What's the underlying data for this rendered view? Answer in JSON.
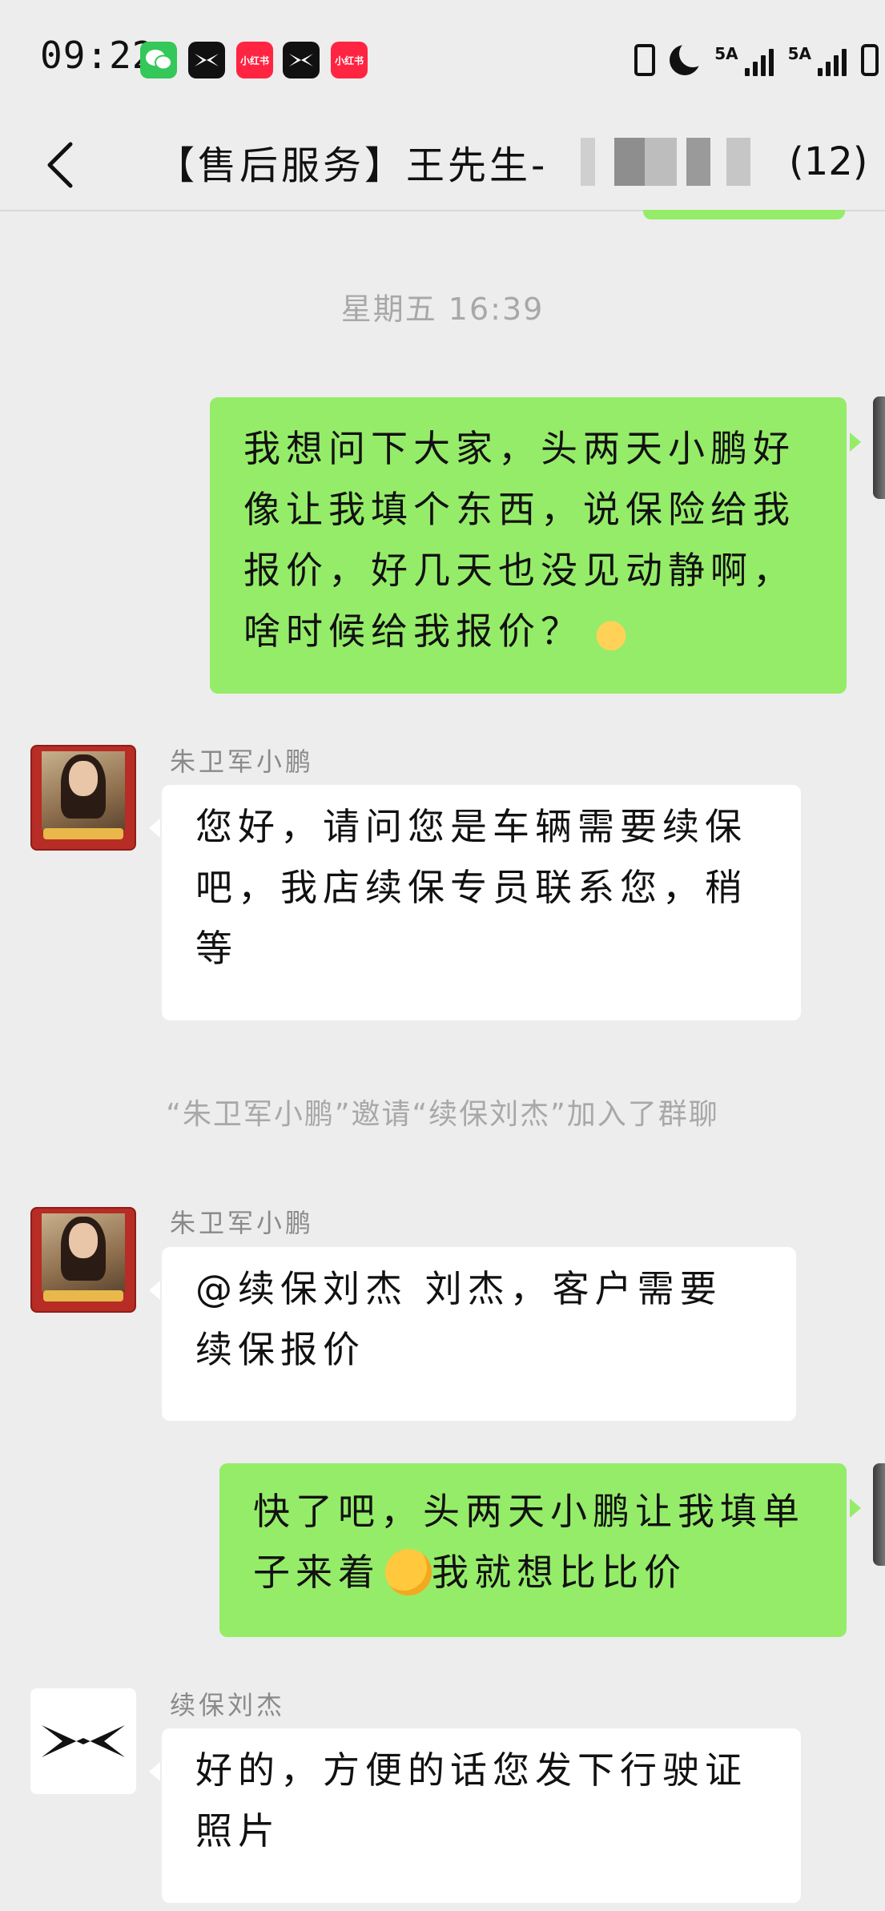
{
  "status_bar": {
    "time": "09:22",
    "app_icons": [
      "wechat-icon",
      "xpeng-icon",
      "xiaohongshu-icon",
      "xpeng-icon",
      "xiaohongshu-icon"
    ],
    "xiaohongshu_label": "小红书",
    "network_1": "5A",
    "network_2": "5A"
  },
  "header": {
    "title": "【售后服务】王先生-",
    "member_count": "(12)"
  },
  "messages": {
    "timestamp": "星期五 16:39",
    "m1": {
      "text": "我想问下大家，头两天小鹏好像让我填个东西，说保险给我报价，好几天也没见动静啊，啥时候给我报价？"
    },
    "m2": {
      "sender": "朱卫军小鹏",
      "text": "您好，请问您是车辆需要续保吧，我店续保专员联系您，稍等"
    },
    "system": "“朱卫军小鹏”邀请“续保刘杰”加入了群聊",
    "m3": {
      "sender": "朱卫军小鹏",
      "text": "@续保刘杰 刘杰，客户需要续保报价"
    },
    "m4": {
      "text_before": "快了吧，头两天小鹏让我填单子来着",
      "text_after": "我就想比比价"
    },
    "m5": {
      "sender": "续保刘杰",
      "text": "好的，方便的话您发下行驶证照片"
    }
  },
  "colors": {
    "background": "#ededed",
    "outgoing_bubble": "#95ec69",
    "incoming_bubble": "#ffffff"
  }
}
